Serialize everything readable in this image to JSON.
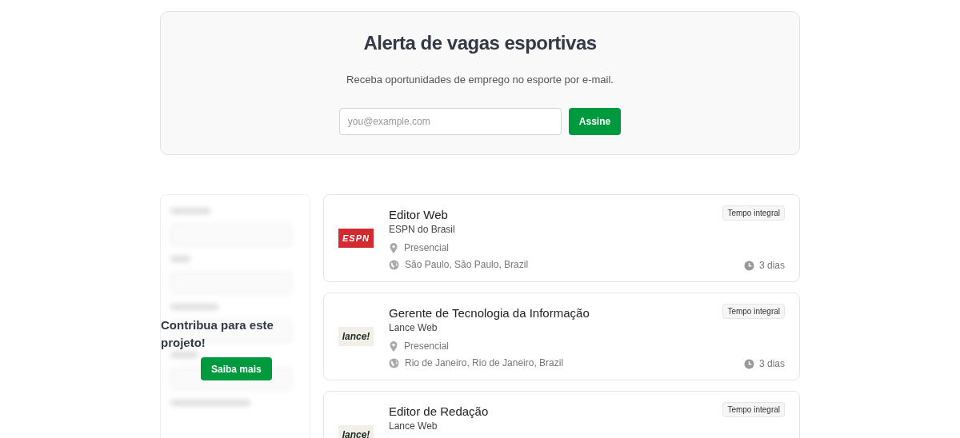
{
  "alert": {
    "title": "Alerta de vagas esportivas",
    "subtitle": "Receba oportunidades de emprego no esporte por e-mail.",
    "email": {
      "placeholder": "you@example.com"
    },
    "button": "Assine"
  },
  "sidebar": {
    "heading": "Contribua para este projeto!",
    "button": "Saiba mais"
  },
  "jobs": [
    {
      "title": "Editor Web",
      "company": "ESPN do Brasil",
      "logo": {
        "kind": "espn",
        "text": "ESPN"
      },
      "workplace": "Presencial",
      "location": "São Paulo, São Paulo, Brazil",
      "type": "Tempo integral",
      "age": "3 dias"
    },
    {
      "title": "Gerente de Tecnologia da Informação",
      "company": "Lance Web",
      "logo": {
        "kind": "lance",
        "text": "lance!"
      },
      "workplace": "Presencial",
      "location": "Rio de Janeiro, Rio de Janeiro, Brazil",
      "type": "Tempo integral",
      "age": "3 dias"
    },
    {
      "title": "Editor de Redação",
      "company": "Lance Web",
      "logo": {
        "kind": "lance",
        "text": "lance!"
      },
      "type": "Tempo integral"
    }
  ]
}
